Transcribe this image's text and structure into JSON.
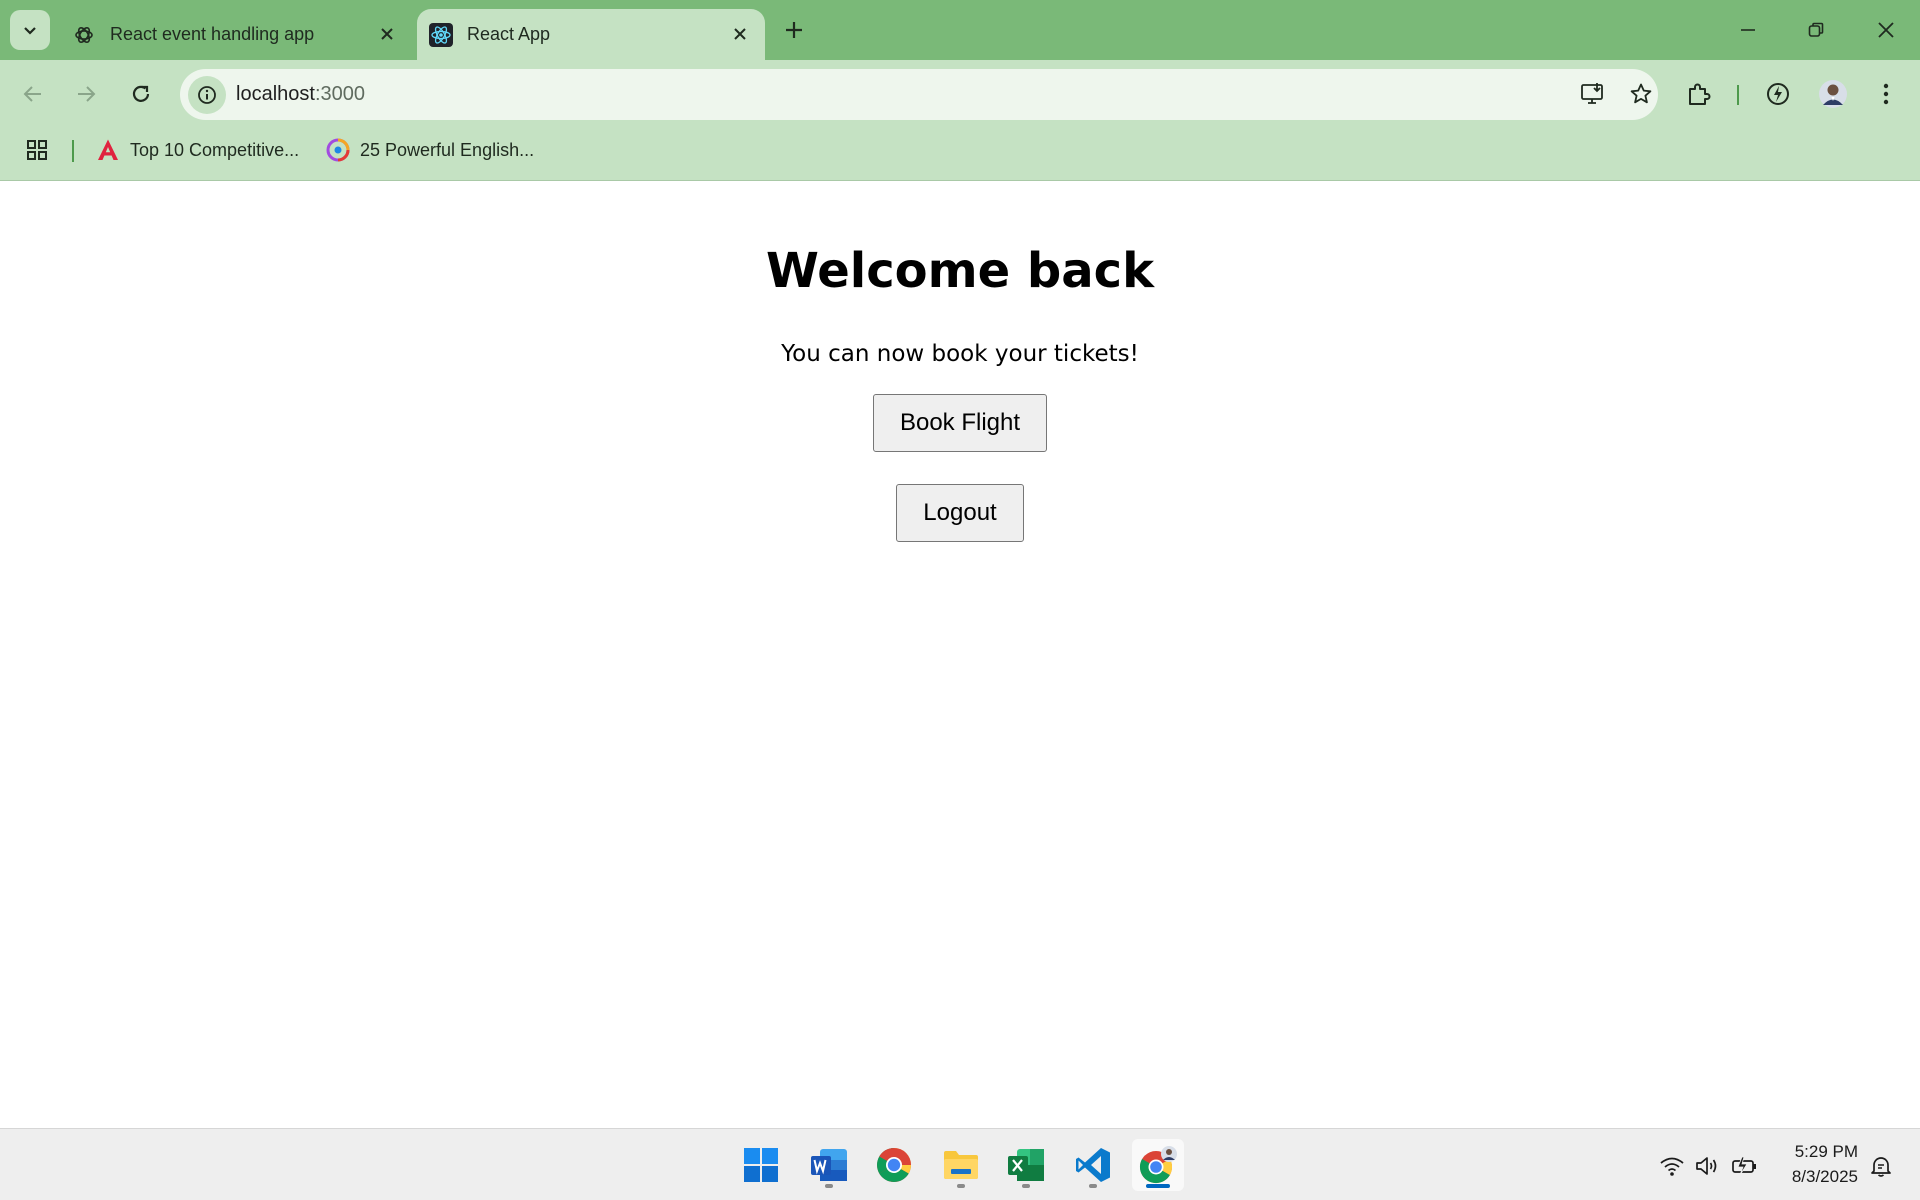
{
  "browser": {
    "tabs": [
      {
        "label": "React event handling app",
        "active": false,
        "favicon": "openai-icon"
      },
      {
        "label": "React App",
        "active": true,
        "favicon": "react-icon"
      }
    ],
    "url_host": "localhost",
    "url_port": ":3000",
    "bookmarks": [
      {
        "label": "Top 10 Competitive...",
        "icon": "angular-icon"
      },
      {
        "label": "25 Powerful English...",
        "icon": "colorful-logo-icon"
      }
    ]
  },
  "page": {
    "title": "Welcome back",
    "subtitle": "You can now book your tickets!",
    "book_button": "Book Flight",
    "logout_button": "Logout"
  },
  "taskbar": {
    "apps": [
      "start-icon",
      "word-icon",
      "chrome-icon",
      "file-explorer-icon",
      "excel-icon",
      "vscode-icon",
      "chrome-profile-icon"
    ],
    "time": "5:29 PM",
    "date": "8/3/2025"
  },
  "colors": {
    "tabstrip": "#7ab978",
    "toolbar": "#c5e2c3",
    "omnibox": "#eef6ed"
  }
}
